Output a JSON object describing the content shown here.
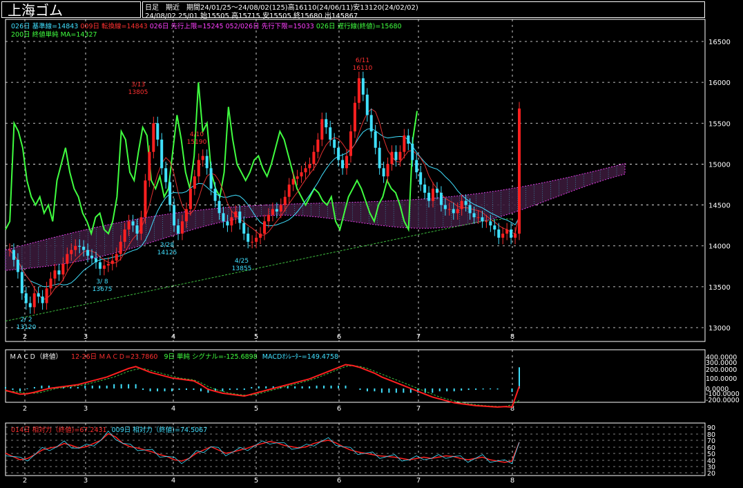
{
  "header": {
    "title": "上海ゴム",
    "line1": "日足　期近　期間24/01/25～24/08/02(125)高16110(24/06/11)安13120(24/02/02)",
    "line2": "24/08/02 25/01 始15505 高15715 安15505 終15680 出145867"
  },
  "indicators_main": [
    {
      "text": "026日 基準線=14843",
      "color": "#40e0ff"
    },
    {
      "text": "009日 転換線=14843",
      "color": "#ff3030"
    },
    {
      "text": "026日 先行上限=15245",
      "color": "#ff40ff"
    },
    {
      "text": "052/026日 先行下限=15033",
      "color": "#ff40ff"
    },
    {
      "text": "026日 遅行線(終値)=15680",
      "color": "#40ff40"
    }
  ],
  "indicators_main2": [
    {
      "text": "200日 終値単純 MA=14327",
      "color": "#40ff40"
    }
  ],
  "macd_label": [
    {
      "text": "ＭＡＣＤ（終値）",
      "color": "#ffffff"
    },
    {
      "text": "12-26日 ＭＡＣＤ=23.7860",
      "color": "#ff3030"
    },
    {
      "text": "9日 単純 シグナル=-125.6898",
      "color": "#40ff40"
    },
    {
      "text": "MACDｵｼﾚｰﾀｰ=149.4758",
      "color": "#40e0ff"
    }
  ],
  "rsi_label": [
    {
      "text": "014日 相対力（終値)=67.2431",
      "color": "#ff3030"
    },
    {
      "text": "009日 相対力（終値)=74.5067",
      "color": "#40e0ff"
    }
  ],
  "price_axis": [
    "16500",
    "16000",
    "15500",
    "15000",
    "14500",
    "14000",
    "13500",
    "13000"
  ],
  "macd_axis": [
    "400.0000",
    "300.0000",
    "200.0000",
    "100.0000",
    "0.0000",
    "-100.0000",
    "-200.0000"
  ],
  "rsi_axis": [
    "90",
    "80",
    "70",
    "60",
    "50",
    "40",
    "30",
    "20"
  ],
  "month_labels": [
    "2",
    "3",
    "4",
    "5",
    "6",
    "7",
    "8"
  ],
  "annotations": [
    {
      "date": "2/ 2",
      "value": "13120",
      "color": "#40e0ff"
    },
    {
      "date": "3/ 8",
      "value": "13675",
      "color": "#40e0ff"
    },
    {
      "date": "3/13",
      "value": "13805",
      "color": "#ff3030"
    },
    {
      "date": "3/28",
      "value": "14125",
      "color": "#40e0ff"
    },
    {
      "date": "4/10",
      "value": "15190",
      "color": "#ff3030"
    },
    {
      "date": "4/25",
      "value": "13855",
      "color": "#40e0ff"
    },
    {
      "date": "6/11",
      "value": "16110",
      "color": "#ff3030"
    }
  ],
  "chart_data": {
    "type": "candlestick",
    "price_range": [
      13000,
      16600
    ],
    "macd_range": [
      -250,
      400
    ],
    "rsi_range": [
      20,
      90
    ],
    "candle_count": 125,
    "closes": [
      13950,
      13830,
      13680,
      13420,
      13300,
      13250,
      13420,
      13380,
      13300,
      13480,
      13600,
      13700,
      13650,
      13780,
      13900,
      13950,
      14000,
      13990,
      13950,
      13880,
      13850,
      13800,
      13720,
      13760,
      13780,
      13820,
      13900,
      14050,
      14200,
      14300,
      14250,
      14150,
      14350,
      14800,
      15150,
      15500,
      15300,
      14950,
      14780,
      14500,
      14250,
      14150,
      14300,
      14450,
      14700,
      14850,
      15050,
      15100,
      14950,
      14700,
      14550,
      14400,
      14300,
      14250,
      14350,
      14420,
      14280,
      14150,
      14050,
      14050,
      14100,
      14150,
      14300,
      14380,
      14450,
      14420,
      14500,
      14600,
      14750,
      14820,
      14850,
      14900,
      14950,
      15000,
      15150,
      15300,
      15550,
      15450,
      15300,
      15200,
      15050,
      14950,
      15100,
      15400,
      15750,
      16050,
      15850,
      15600,
      15400,
      15200,
      14950,
      14850,
      15000,
      15150,
      15050,
      15150,
      15350,
      15250,
      15050,
      14900,
      14750,
      14650,
      14550,
      14700,
      14650,
      14500,
      14450,
      14450,
      14400,
      14450,
      14550,
      14500,
      14400,
      14350,
      14350,
      14300,
      14300,
      14250,
      14200,
      14100,
      14150,
      14200,
      14100,
      14150,
      15680
    ],
    "ma200": [
      13080,
      13100,
      13120,
      13140,
      13160,
      13180,
      13200,
      13220,
      13240,
      13260,
      13280,
      13300,
      13320,
      13340,
      13360,
      13380,
      13400,
      13420,
      13440,
      13460,
      13480,
      13500,
      13520,
      13540,
      13560,
      13580,
      13600,
      13620,
      13640,
      13660,
      13680,
      13700,
      13720,
      13740,
      13760,
      13780,
      13800,
      13820,
      13840,
      13860,
      13880,
      13900,
      13920,
      13940,
      13960,
      13980,
      14000,
      14020,
      14040,
      14060,
      14080,
      14100,
      14120,
      14140,
      14160,
      14180,
      14200,
      14220,
      14240,
      14260,
      14280,
      14300,
      14310,
      14320,
      14330,
      14327
    ],
    "lagging_span": [
      14200,
      14300,
      15500,
      15400,
      15200,
      14800,
      14600,
      14500,
      14600,
      14400,
      14500,
      14300,
      14800,
      15000,
      15200,
      14900,
      14700,
      14600,
      14400,
      14300,
      14150,
      14350,
      14400,
      14200,
      14150,
      14300,
      14600,
      15400,
      15300,
      14900,
      14800,
      15150,
      15450,
      15350,
      14800,
      14700,
      14850,
      14600,
      14700,
      15150,
      15600,
      15300,
      14900,
      14700,
      15100,
      16000,
      15400,
      15500,
      14900,
      14700,
      14600,
      14900,
      15700,
      15300,
      15000,
      14900,
      14800,
      14900,
      15050,
      15100,
      14950,
      14850,
      15000,
      15200,
      15400,
      15300,
      15100,
      14900,
      14700,
      14600,
      14500,
      14600,
      14700,
      14650,
      14550,
      14500,
      14600,
      14300,
      14200,
      14400,
      14600,
      14700,
      14800,
      14700,
      14550,
      14400,
      14300,
      14500,
      14600,
      14800,
      14700,
      14650,
      14500,
      14300,
      14200,
      15300,
      15650
    ],
    "macd": [
      -20,
      -40,
      -60,
      -55,
      -40,
      -20,
      0,
      10,
      20,
      30,
      40,
      60,
      80,
      100,
      120,
      150,
      180,
      210,
      230,
      200,
      170,
      150,
      130,
      110,
      100,
      90,
      80,
      40,
      -10,
      -30,
      -50,
      -60,
      -70,
      -80,
      -60,
      -40,
      -20,
      0,
      20,
      40,
      60,
      80,
      100,
      130,
      160,
      190,
      220,
      250,
      240,
      220,
      190,
      160,
      120,
      90,
      60,
      30,
      0,
      -30,
      -60,
      -90,
      -110,
      -130,
      -150,
      -160,
      -170,
      -180,
      -185,
      -190,
      -195,
      -190,
      -195,
      23
    ],
    "macd_signal": [
      -30,
      -30,
      -40,
      -50,
      -50,
      -40,
      -20,
      0,
      10,
      20,
      30,
      40,
      60,
      80,
      100,
      120,
      150,
      180,
      200,
      210,
      190,
      170,
      150,
      130,
      110,
      100,
      90,
      60,
      20,
      -10,
      -30,
      -50,
      -60,
      -70,
      -70,
      -55,
      -35,
      -15,
      5,
      25,
      45,
      65,
      85,
      110,
      140,
      170,
      200,
      230,
      240,
      230,
      210,
      180,
      150,
      120,
      90,
      60,
      30,
      0,
      -30,
      -60,
      -90,
      -110,
      -130,
      -145,
      -160,
      -170,
      -178,
      -184,
      -188,
      -190,
      -170,
      -125
    ],
    "rsi14": [
      50,
      45,
      40,
      42,
      48,
      55,
      58,
      60,
      65,
      62,
      58,
      60,
      65,
      70,
      80,
      75,
      65,
      60,
      58,
      55,
      52,
      48,
      45,
      40,
      38,
      42,
      50,
      55,
      60,
      55,
      50,
      52,
      55,
      58,
      62,
      65,
      68,
      66,
      62,
      60,
      58,
      60,
      65,
      68,
      70,
      66,
      60,
      55,
      52,
      50,
      48,
      46,
      45,
      44,
      42,
      40,
      42,
      44,
      42,
      44,
      46,
      45,
      42,
      40,
      42,
      44,
      40,
      38,
      36,
      38,
      67
    ]
  }
}
